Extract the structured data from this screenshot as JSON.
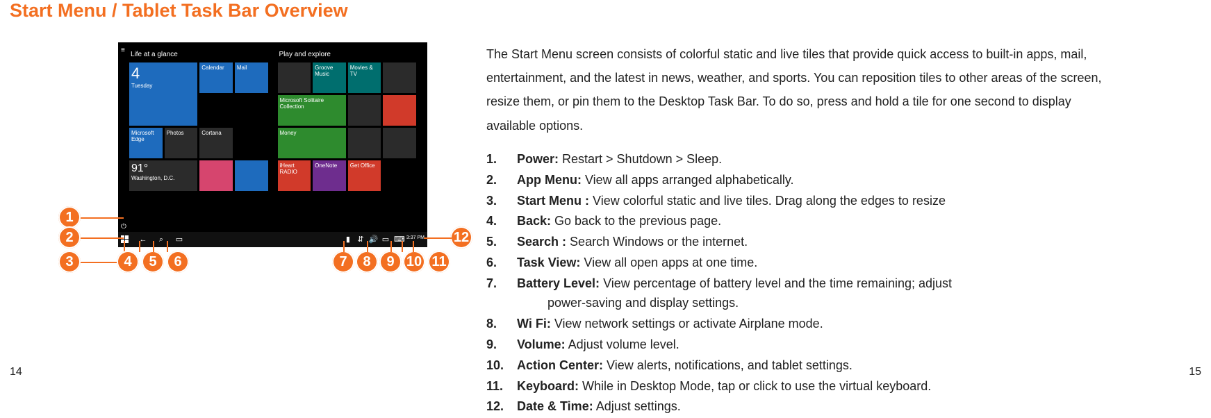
{
  "title": "Start Menu / Tablet Task Bar Overview",
  "intro": "The Start Menu screen consists of colorful static and live tiles that provide quick access to built-in apps, mail, entertainment, and the latest in news, weather, and sports. You can reposition tiles to other areas of the screen, resize them, or pin them to the Desktop Task Bar. To do so, press and hold a tile for one second to display available options.",
  "screenshot": {
    "group_left_label": "Life at a glance",
    "group_right_label": "Play and explore",
    "date_tile_num": "4",
    "date_tile_day": "Tuesday",
    "weather_temp": "91°",
    "weather_loc": "Washington, D.C.",
    "tile_calendar": "Calendar",
    "tile_mail": "Mail",
    "tile_edge": "Microsoft Edge",
    "tile_photos": "Photos",
    "tile_cortana": "Cortana",
    "tile_solitaire": "Microsoft Solitaire Collection",
    "tile_groove": "Groove Music",
    "tile_movies": "Movies & TV",
    "tile_money": "Money",
    "tile_onenote": "OneNote",
    "tile_office": "Get Office",
    "tile_iheart": "iHeart RADIO"
  },
  "callouts": {
    "c1": "1",
    "c2": "2",
    "c3": "3",
    "c4": "4",
    "c5": "5",
    "c6": "6",
    "c7": "7",
    "c8": "8",
    "c9": "9",
    "c10": "10",
    "c11": "11",
    "c12": "12"
  },
  "legend": [
    {
      "num": "1.",
      "label": "Power:",
      "desc": " Restart > Shutdown > Sleep."
    },
    {
      "num": "2.",
      "label": "App Menu:",
      "desc": " View all apps arranged alphabetically."
    },
    {
      "num": "3.",
      "label": "Start Menu :",
      "desc": " View colorful static and live tiles. Drag along the edges to resize"
    },
    {
      "num": "4.",
      "label": "Back:",
      "desc": " Go back to the previous page."
    },
    {
      "num": "5.",
      "label": "Search :",
      "desc": " Search Windows or the internet."
    },
    {
      "num": "6.",
      "label": "Task View:",
      "desc": " View all open apps at one time."
    },
    {
      "num": "7.",
      "label": "Battery Level:",
      "desc": " View percentage of battery level and the time remaining; adjust",
      "desc2": "power-saving and display settings."
    },
    {
      "num": "8.",
      "label": "Wi Fi:",
      "desc": " View network settings or activate Airplane mode."
    },
    {
      "num": "9.",
      "label": "Volume:",
      "desc": " Adjust volume level."
    },
    {
      "num": "10.",
      "label": "Action Center:",
      "desc": " View alerts, notifications, and tablet settings."
    },
    {
      "num": "11.",
      "label": "Keyboard:",
      "desc": " While in Desktop Mode, tap or click to use the virtual keyboard."
    },
    {
      "num": "12.",
      "label": "Date & Time:",
      "desc": " Adjust settings."
    }
  ],
  "page_left": "14",
  "page_right": "15"
}
